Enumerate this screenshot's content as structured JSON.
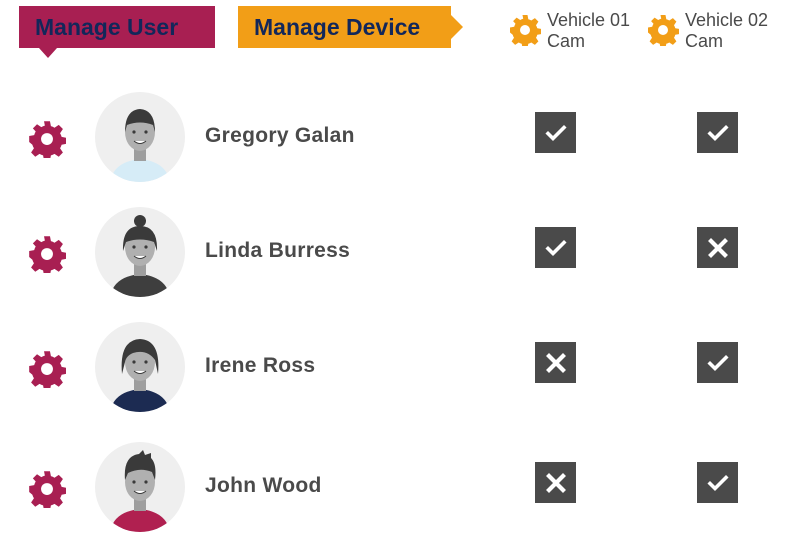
{
  "tabs": {
    "manage_user": "Manage User",
    "manage_device": "Manage Device"
  },
  "columns": [
    {
      "label": "Vehicle 01 Cam",
      "icon": "gear-icon"
    },
    {
      "label": "Vehicle 02 Cam",
      "icon": "gear-icon"
    }
  ],
  "users": [
    {
      "name": "Gregory Galan",
      "access": [
        true,
        true
      ],
      "shirt_color": "#d6ecf7"
    },
    {
      "name": "Linda Burress",
      "access": [
        true,
        false
      ],
      "shirt_color": "#3e3e3e"
    },
    {
      "name": "Irene Ross",
      "access": [
        false,
        true
      ],
      "shirt_color": "#1c2b52"
    },
    {
      "name": "John Wood",
      "access": [
        false,
        true
      ],
      "shirt_color": "#b02050"
    }
  ],
  "colors": {
    "accent_user": "#a81f52",
    "accent_device": "#f29e17",
    "checkbox_bg": "#4a4a4a"
  }
}
